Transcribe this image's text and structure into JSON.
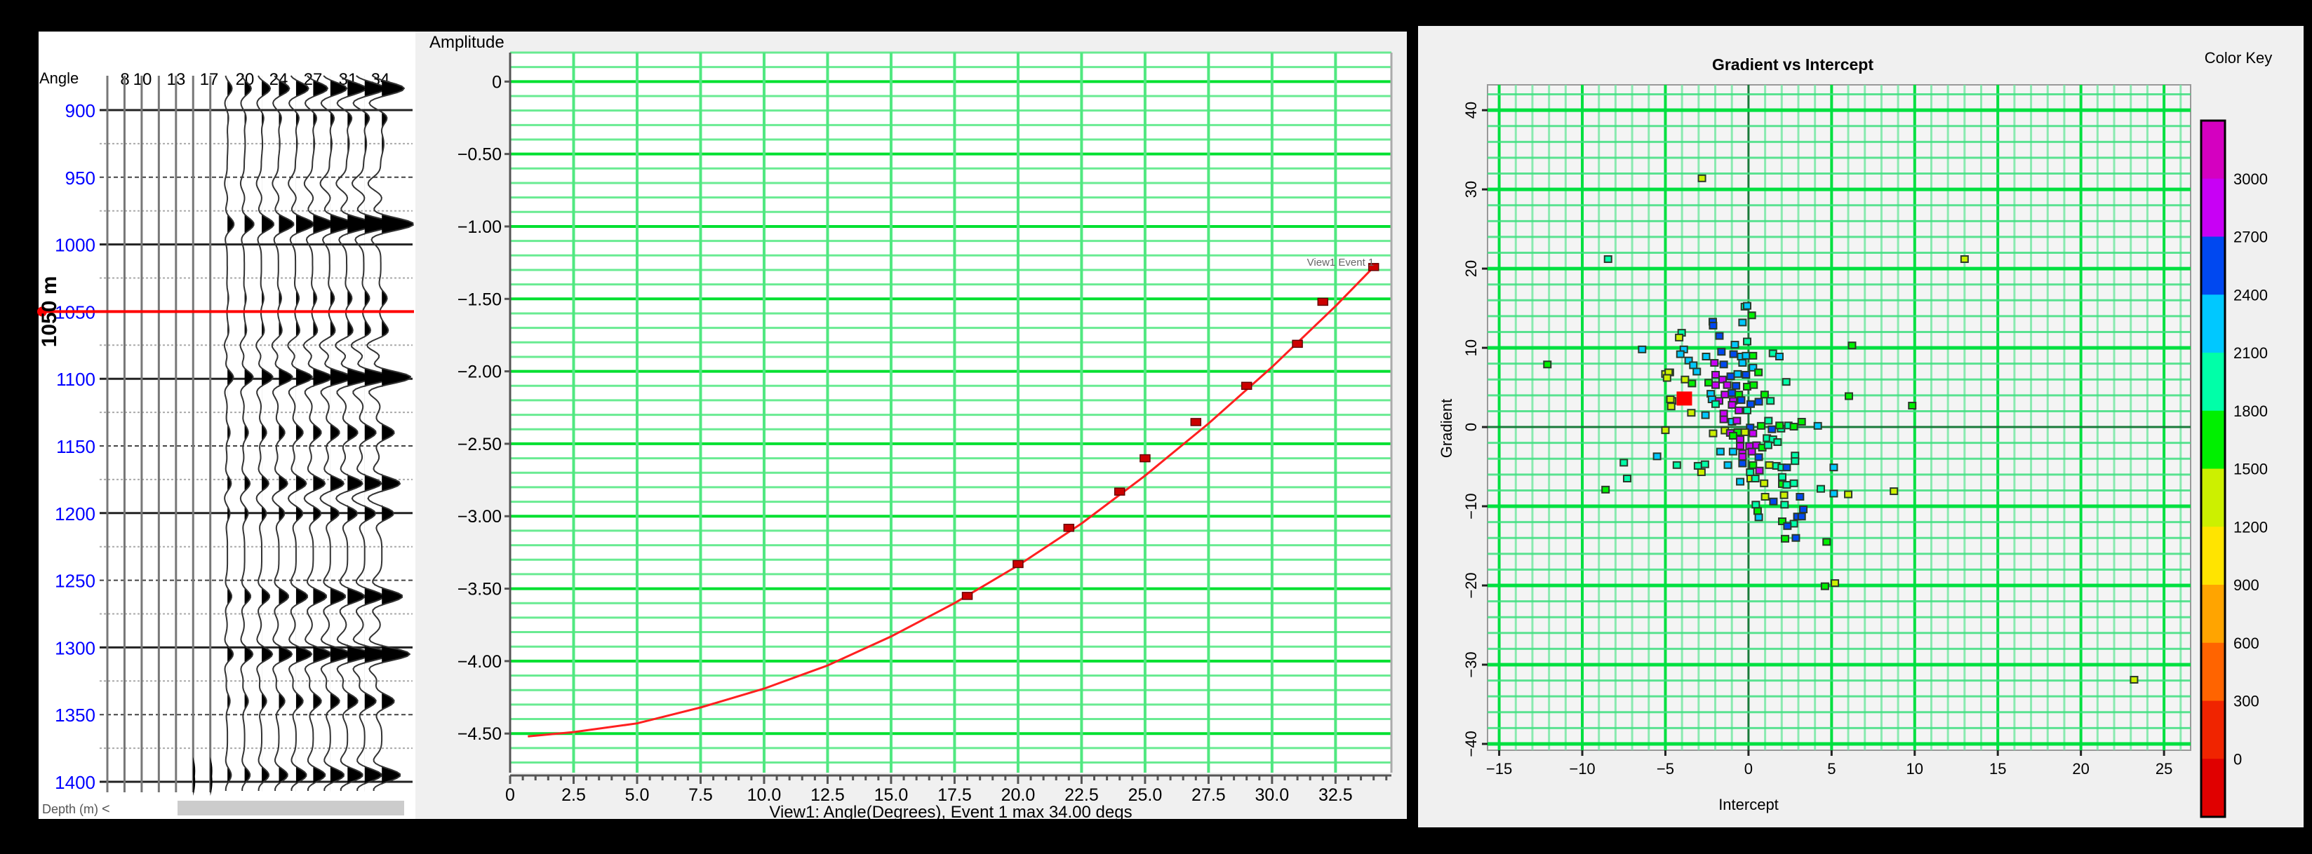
{
  "seismic": {
    "angle_label": "Angle",
    "angles": [
      "8",
      "10",
      "13",
      "17",
      "20",
      "24",
      "27",
      "31",
      "34"
    ],
    "depth_ticks": [
      "900",
      "950",
      "1000",
      "1050",
      "1100",
      "1150",
      "1200",
      "1250",
      "1300",
      "1350",
      "1400"
    ],
    "marker_label": "1050 m",
    "marker_depth": 1050,
    "marker_color": "#ff0000",
    "depth_axis_label": "Depth (m)",
    "scroll_left": "<",
    "scroll_right": ">",
    "scroll_up": "^",
    "scroll_down": "v"
  },
  "chart_data": [
    {
      "type": "line",
      "ylabel": "Amplitude",
      "xlabel": "View1: Angle(Degrees), Event 1 max 34.00 degs",
      "xlim": [
        0,
        34.7
      ],
      "ylim": [
        -4.77,
        0.2
      ],
      "grid": true,
      "xticks": [
        "0",
        "2.5",
        "5.0",
        "7.5",
        "10.0",
        "12.5",
        "15.0",
        "17.5",
        "20.0",
        "22.5",
        "25.0",
        "27.5",
        "30.0",
        "32.5"
      ],
      "yticks": [
        "0",
        "−0.50",
        "−1.00",
        "−1.50",
        "−2.00",
        "−2.50",
        "−3.00",
        "−3.50",
        "−4.00",
        "−4.50"
      ],
      "series_label": "View1 Event 1",
      "points": {
        "x": [
          18,
          20,
          22,
          24,
          25,
          27,
          29,
          31,
          32,
          34
        ],
        "y": [
          -3.55,
          -3.33,
          -3.08,
          -2.83,
          -2.6,
          -2.35,
          -2.1,
          -1.81,
          -1.52,
          -1.28
        ]
      },
      "curve": {
        "x": [
          0.7,
          2.5,
          5,
          7.5,
          10,
          12.5,
          15,
          17.5,
          20,
          22.5,
          25,
          27.5,
          30,
          32.5,
          34
        ],
        "y": [
          -4.52,
          -4.49,
          -4.43,
          -4.32,
          -4.19,
          -4.03,
          -3.83,
          -3.6,
          -3.34,
          -3.05,
          -2.72,
          -2.36,
          -1.97,
          -1.55,
          -1.28
        ]
      },
      "colors": {
        "line": "#ff2020",
        "point": "#cc0000",
        "grid_major": "#00e030",
        "grid_minor": "#50e880"
      }
    },
    {
      "type": "scatter",
      "title": "Gradient vs Intercept",
      "xlabel": "Intercept",
      "ylabel": "Gradient",
      "xlim": [
        -15.7,
        26.6
      ],
      "ylim": [
        -40.8,
        43.2
      ],
      "grid": true,
      "xticks": [
        "-15",
        "-10",
        "-5",
        "0",
        "5",
        "10",
        "15",
        "20",
        "25"
      ],
      "yticks": [
        "-40",
        "-30",
        "-20",
        "-10",
        "0",
        "10",
        "20",
        "30",
        "40"
      ],
      "highlight": {
        "x": -3.86,
        "y": 3.6,
        "color": "#ff0000"
      },
      "points": [
        [
          -0.22,
          15.2,
          1950
        ],
        [
          -0.08,
          15.3,
          2250
        ],
        [
          0.2,
          14.1,
          1650
        ],
        [
          -2.15,
          13.3,
          2550
        ],
        [
          -2.13,
          12.8,
          2550
        ],
        [
          -0.36,
          13.2,
          2250
        ],
        [
          -1.75,
          11.5,
          2550
        ],
        [
          -4.02,
          11.9,
          1950
        ],
        [
          -4.17,
          11.3,
          1350
        ],
        [
          -0.08,
          10.8,
          1950
        ],
        [
          -0.82,
          10.4,
          2250
        ],
        [
          6.23,
          10.3,
          1650
        ],
        [
          -3.89,
          9.8,
          2250
        ],
        [
          -4.1,
          9.2,
          2250
        ],
        [
          -2.55,
          8.9,
          2250
        ],
        [
          -1.63,
          9.5,
          2550
        ],
        [
          -0.9,
          9.2,
          2550
        ],
        [
          -0.44,
          8.9,
          2250
        ],
        [
          -0.15,
          9.0,
          2250
        ],
        [
          0.27,
          9.0,
          1650
        ],
        [
          1.47,
          9.3,
          1950
        ],
        [
          1.86,
          8.9,
          2250
        ],
        [
          -3.6,
          8.4,
          2250
        ],
        [
          -3.32,
          7.8,
          2250
        ],
        [
          -3.11,
          7.0,
          2250
        ],
        [
          -2.05,
          8.1,
          2850
        ],
        [
          -1.49,
          7.9,
          2550
        ],
        [
          -0.36,
          8.1,
          2250
        ],
        [
          0.27,
          7.5,
          2250
        ],
        [
          0.6,
          6.9,
          1650
        ],
        [
          -4.73,
          6.9,
          1350
        ],
        [
          -1.98,
          6.6,
          2850
        ],
        [
          -1.56,
          6.0,
          2850
        ],
        [
          -1.07,
          6.4,
          2550
        ],
        [
          -0.65,
          6.7,
          2250
        ],
        [
          -0.15,
          6.6,
          2550
        ],
        [
          -3.82,
          6.0,
          1350
        ],
        [
          -3.4,
          5.5,
          1650
        ],
        [
          -2.4,
          5.6,
          1650
        ],
        [
          -1.98,
          5.3,
          2850
        ],
        [
          -1.28,
          5.3,
          2850
        ],
        [
          -0.75,
          5.2,
          2550
        ],
        [
          -0.08,
          5.1,
          1650
        ],
        [
          0.31,
          5.3,
          1650
        ],
        [
          2.27,
          5.7,
          1950
        ],
        [
          -2.27,
          4.2,
          2250
        ],
        [
          -1.42,
          4.1,
          2850
        ],
        [
          -1.0,
          4.3,
          2550
        ],
        [
          -0.58,
          4.1,
          1650
        ],
        [
          0.97,
          4.1,
          1650
        ],
        [
          1.32,
          3.3,
          1950
        ],
        [
          6.04,
          3.9,
          1650
        ],
        [
          9.85,
          2.7,
          1650
        ],
        [
          -4.59,
          3.3,
          1350
        ],
        [
          -2.2,
          3.5,
          2250
        ],
        [
          -1.77,
          3.3,
          2850
        ],
        [
          -0.92,
          3.3,
          2850
        ],
        [
          -0.44,
          3.4,
          2550
        ],
        [
          0.13,
          2.9,
          2550
        ],
        [
          0.62,
          3.2,
          2550
        ],
        [
          -1.98,
          2.9,
          1950
        ],
        [
          -0.99,
          2.8,
          2850
        ],
        [
          -0.08,
          2.1,
          1950
        ],
        [
          -0.58,
          2.1,
          2850
        ],
        [
          -3.44,
          1.8,
          1350
        ],
        [
          -2.59,
          1.5,
          2250
        ],
        [
          -1.49,
          1.7,
          2850
        ],
        [
          -1.49,
          0.97,
          2850
        ],
        [
          -0.99,
          0.67,
          2250
        ],
        [
          -0.7,
          0.8,
          2850
        ],
        [
          1.2,
          0.8,
          1950
        ],
        [
          3.2,
          0.67,
          1650
        ],
        [
          4.17,
          0.15,
          2250
        ],
        [
          0.76,
          0.15,
          1650
        ],
        [
          1.41,
          -0.28,
          2550
        ],
        [
          1.96,
          -0.2,
          1950
        ],
        [
          2.4,
          0.2,
          1950
        ],
        [
          2.73,
          0.05,
          1650
        ],
        [
          1.87,
          0.2,
          1650
        ],
        [
          0.1,
          -0.06,
          2550
        ],
        [
          -2.13,
          -0.8,
          1350
        ],
        [
          -1.42,
          -0.44,
          1350
        ],
        [
          -1.1,
          -0.74,
          2850
        ],
        [
          -0.65,
          -0.65,
          1650
        ],
        [
          -0.22,
          -0.65,
          1350
        ],
        [
          0.27,
          -0.8,
          2850
        ],
        [
          -0.93,
          -1.1,
          1650
        ],
        [
          -0.5,
          -1.55,
          2850
        ],
        [
          1.11,
          -1.4,
          1950
        ],
        [
          1.47,
          -1.55,
          1950
        ],
        [
          1.75,
          -1.9,
          1950
        ],
        [
          -0.5,
          -2.4,
          2850
        ],
        [
          0.06,
          -2.4,
          2850
        ],
        [
          0.48,
          -2.3,
          2850
        ],
        [
          0.83,
          -2.6,
          1650
        ],
        [
          1.18,
          -2.3,
          1950
        ],
        [
          -1.69,
          -3.1,
          2250
        ],
        [
          -0.93,
          -3.1,
          2250
        ],
        [
          -0.36,
          -3.3,
          2850
        ],
        [
          0.2,
          -3.1,
          2850
        ],
        [
          0.62,
          -3.8,
          2550
        ],
        [
          -0.36,
          -3.75,
          2850
        ],
        [
          2.8,
          -3.6,
          1950
        ],
        [
          2.8,
          -4.3,
          1950
        ],
        [
          -4.31,
          -4.8,
          1950
        ],
        [
          -3.04,
          -4.9,
          1950
        ],
        [
          -2.62,
          -4.7,
          1950
        ],
        [
          -2.83,
          -5.7,
          1350
        ],
        [
          -1.24,
          -4.8,
          2250
        ],
        [
          -0.36,
          -4.6,
          2550
        ],
        [
          0.27,
          -4.8,
          1650
        ],
        [
          1.25,
          -4.8,
          1350
        ],
        [
          1.68,
          -4.9,
          1950
        ],
        [
          2.0,
          -5.1,
          1950
        ],
        [
          2.3,
          -5.1,
          2550
        ],
        [
          5.13,
          -5.1,
          2250
        ],
        [
          0.66,
          -5.5,
          2850
        ],
        [
          0.1,
          -5.7,
          1950
        ],
        [
          2.03,
          -6.3,
          1950
        ],
        [
          -0.5,
          -6.9,
          2250
        ],
        [
          0.13,
          -6.5,
          1350
        ],
        [
          0.41,
          -6.5,
          1950
        ],
        [
          0.94,
          -7.1,
          1350
        ],
        [
          2.03,
          -7.2,
          1650
        ],
        [
          2.3,
          -7.3,
          1950
        ],
        [
          2.73,
          -7.1,
          1950
        ],
        [
          4.35,
          -7.8,
          1950
        ],
        [
          5.13,
          -8.4,
          2250
        ],
        [
          6.0,
          -8.5,
          1350
        ],
        [
          8.75,
          -8.1,
          1350
        ],
        [
          1.0,
          -8.8,
          1350
        ],
        [
          2.14,
          -8.6,
          1350
        ],
        [
          3.1,
          -8.8,
          2550
        ],
        [
          1.5,
          -9.4,
          2550
        ],
        [
          0.44,
          -9.8,
          1950
        ],
        [
          2.17,
          -9.8,
          1950
        ],
        [
          0.55,
          -10.6,
          1650
        ],
        [
          3.3,
          -10.4,
          2550
        ],
        [
          0.62,
          -11.4,
          2250
        ],
        [
          2.94,
          -11.3,
          2550
        ],
        [
          3.2,
          -11.3,
          2550
        ],
        [
          2.03,
          -11.9,
          1650
        ],
        [
          2.73,
          -12.2,
          1950
        ],
        [
          2.34,
          -12.5,
          2550
        ],
        [
          2.2,
          -14.1,
          1650
        ],
        [
          2.85,
          -14.0,
          2550
        ],
        [
          4.7,
          -14.5,
          1650
        ],
        [
          -12.1,
          7.9,
          1650
        ],
        [
          -6.4,
          9.8,
          2250
        ],
        [
          -5.0,
          6.7,
          1350
        ],
        [
          -4.8,
          6.9,
          1350
        ],
        [
          -4.9,
          6.2,
          1350
        ],
        [
          -4.7,
          3.5,
          1350
        ],
        [
          -4.65,
          2.6,
          1350
        ],
        [
          -5.0,
          -0.4,
          1350
        ],
        [
          -5.5,
          -3.7,
          2250
        ],
        [
          -7.5,
          -4.5,
          1950
        ],
        [
          -7.3,
          -6.5,
          1950
        ],
        [
          -8.6,
          -7.9,
          1650
        ],
        [
          -2.8,
          31.4,
          1350
        ],
        [
          -8.45,
          21.2,
          1950
        ],
        [
          13.0,
          21.2,
          1350
        ],
        [
          23.2,
          -31.9,
          1350
        ],
        [
          4.6,
          -20.1,
          1650
        ],
        [
          5.2,
          -19.7,
          1350
        ]
      ],
      "color_key": {
        "title": "Color Key",
        "labels": [
          "3000",
          "2700",
          "2400",
          "2100",
          "1800",
          "1500",
          "1200",
          "900",
          "600",
          "300",
          "0"
        ],
        "band_colors": [
          "#d400c0",
          "#c800f5",
          "#0048f0",
          "#00c8ff",
          "#00ffa8",
          "#00f000",
          "#ccf000",
          "#ffe400",
          "#ffa400",
          "#ff6400",
          "#f02400",
          "#e00000"
        ]
      }
    }
  ]
}
